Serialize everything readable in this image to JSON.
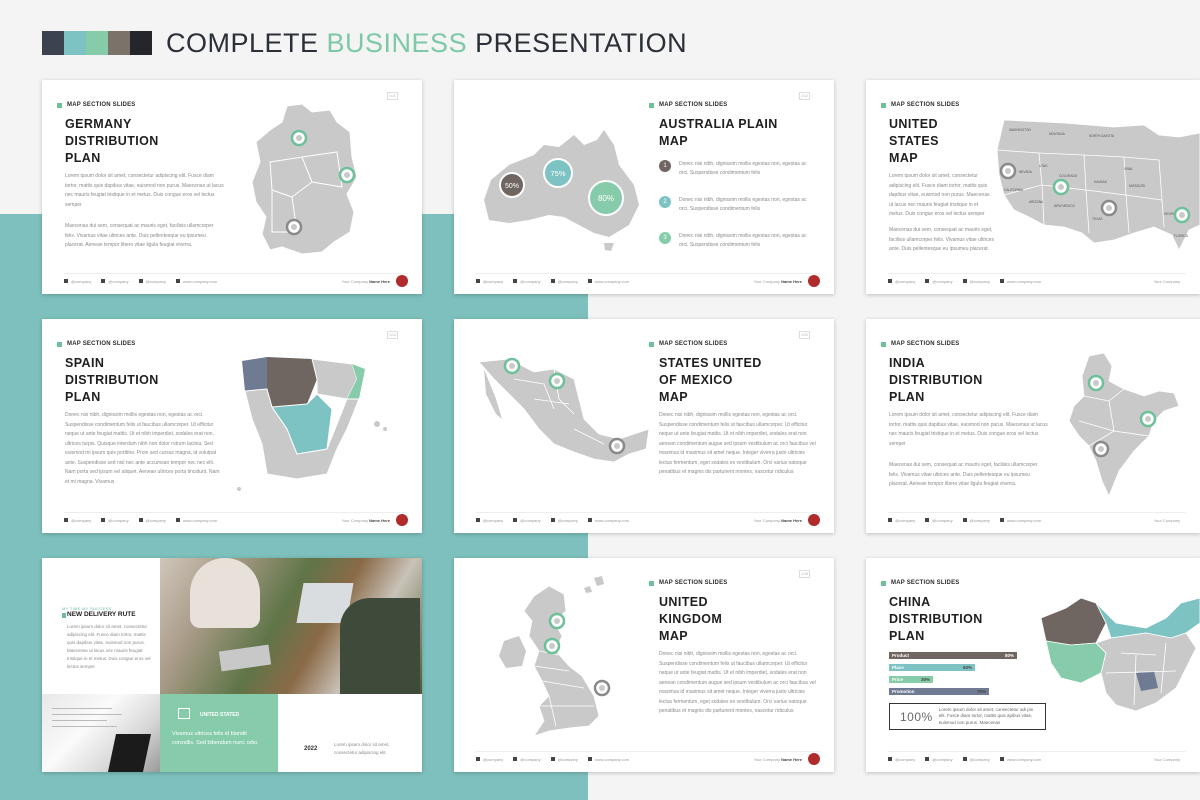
{
  "header": {
    "title_part1": "COMPLETE ",
    "title_accent": "BUSINESS",
    "title_part2": " PRESENTATION",
    "swatches": [
      "#3d4250",
      "#7ec3c4",
      "#86ccaa",
      "#7b7269",
      "#24262b"
    ]
  },
  "colors": {
    "teal_band": "#7dc0bd",
    "accent_green": "#7dc9a7",
    "map_gray": "#c9c9c9",
    "map_brown": "#6f6661",
    "map_slate": "#6f7a93",
    "pin_green": "#6cc09a",
    "pin_gray": "#8a8a8a"
  },
  "common": {
    "section_tag": "MAP SECTION SLIDES",
    "company": "Your Company",
    "company_name": "Name Here",
    "social": [
      "@company",
      "@company",
      "@company",
      "@company",
      "www.company.com"
    ],
    "social_icons": [
      "twitter-icon",
      "facebook-icon",
      "linkedin-icon",
      "instagram-icon",
      "web-icon"
    ]
  },
  "slides": {
    "germany": {
      "heading": "GERMANY\nDISTRIBUTION\nPLAN",
      "page": "101",
      "para1": "Lorem ipsum dolor sit amet, consectetur adipiscing elit. Fusce diam tortor, mattis quis dapibus vitae, euismod non purus. Maecenas ut lacus nec mauris feugiat tristique in et metus. Duis congue eros vel lectus semper",
      "para2": "Maecenas dui sem, consequat ac mauris eget, facilisis ullamcorper felis. Vivamus vitae ultrices ante. Duis pellentesque eu ipsumeu placerat. Aenean tempor libero vitae ligula feugiat viverra."
    },
    "australia": {
      "heading": "AUSTRALIA PLAIN\nMAP",
      "page": "102",
      "bubbles": [
        "50%",
        "75%",
        "80%"
      ],
      "items": [
        {
          "num": "1",
          "text": "Donec nisi nibh, dignissim mollis egestas non, egestas ac orci. Suspendisse condimentum felis",
          "color": "#6f6661"
        },
        {
          "num": "2",
          "text": "Donec nisi nibh, dignissim mollis egestas non, egestas ac orci. Suspendisse condimentum felis",
          "color": "#7ec3c4"
        },
        {
          "num": "3",
          "text": "Donec nisi nibh, dignissim mollis egestas non, egestas ac orci. Suspendisse condimentum felis",
          "color": "#86ccaa"
        }
      ]
    },
    "usa": {
      "heading": "UNITED\nSTATES\nMAP",
      "para1": "Lorem ipsum dolor sit amet, consectetur adipiscing elit. Fusce diam tortor, mattis quis dapibus vitae, euismod non purus. Maecenas ut lacus nec mauris feugiat tristique in et metus. Duis congue eros vel lectus semper",
      "para2": "Maecenas dui sem, consequat ac mauris eget, facilisis ullamcorper felis. Vivamus vitae ultrices ante. Duis pellentesque eu ipsumeu placerat.",
      "states": [
        "WASHINGTON",
        "MONTANA",
        "NORTH DAKOTA",
        "CALIFORNIA",
        "NEVADA",
        "UTAH",
        "COLORADO",
        "KANSAS",
        "TEXAS",
        "NEW MEXICO",
        "ARIZONA",
        "IOWA",
        "MISSOURI",
        "GEORGIA",
        "FLORIDA"
      ]
    },
    "spain": {
      "heading": "SPAIN\nDISTRIBUTION\nPLAN",
      "page": "104",
      "para": "Donec nisi nibh, dignissim mollis egestas non, egestas ac orci. Suspendisse condimentum felis ut faucibus ullamcorper. Ut efficitur neque ut ante feugiat mattis. Ut et nibh imperdiet, sodales erat non, ultrices turpis. Quisque interdum nibh non dolor rutrum lacinia. Sed euismod mi ipsum quis porttitor. Proin sed cursus magna, id volutpat ante. Suspendisse sed nisl nec ante accumsan tempor nec nec elit. Nam porta sed ipsum vel aliquet. Aenean ultrices porta tincidunt. Nam et mi magna. Vivamus"
    },
    "mexico": {
      "heading": "STATES UNITED\nOF MEXICO\nMAP",
      "page": "105",
      "para": "Donec nisi nibh, dignissim mollis egestas non, egestas ac orci. Suspendisse condimentum felis ut faucibus ullamcorper. Ut efficitur neque ut ante feugiat mattis. Ut et nibh imperdiet, sodales erat non aenean condimentum augue sed ipsum vestibulum ac orci faucibus vel maximus id maximus sit amet neque. Integer viverra justo ultricies lectus fermentum, eget sodales ex vestibulum. Orci varius natoque penatibus et magnis dis parturient montes, nascetur ridiculus"
    },
    "india": {
      "heading": "INDIA\nDISTRIBUTION\nPLAN",
      "para1": "Lorem ipsum dolor sit amet, consectetur adipiscing elit. Fusce diam tortor, mattis quis dapibus vitae, euismod non purus. Maecenas ut lacus nec mauris feugiat tristique in et metus. Duis congue eros vel lectus semper",
      "para2": "Maecenas dui sem, consequat ac mauris eget, facilisis ullamcorper felis. Vivamus vitae ultrices ante. Duis pellentesque eu ipsumeu placerat. Aenean tempor libero vitae ligula feugiat viverra."
    },
    "photo": {
      "small_tag": "MY TIME MY SUCCESS",
      "title": "NEW DELIVERY RUTE",
      "para": "Lorem ipsum dolor sit amet, consectetur adipiscing elit. Fusce diam tortor, mattis quis dapibus vitae, euismod non purus. Maecenas ut lacus nec mauris feugiat tristique in et metus. Duis congue eros vel lectus semper",
      "box_title": "UNITED STATED",
      "box_text": "Vivamus ultrices felis id blandit convallis. Sed bibendum nunc odio.",
      "year": "2022",
      "year_text": "Lorem ipsum dolor sit amet, consectetur adipiscing elit."
    },
    "uk": {
      "heading": "UNITED\nKINGDOM\nMAP",
      "page": "108",
      "para": "Donec nisi nibh, dignissim mollis egestas non, egestas ac orci. Suspendisse condimentum felis ut faucibus ullamcorper. Ut efficitur neque ut ante feugiat mattis. Ut et nibh imperdiet, sodales erat non aenean condimentum augue sed ipsum vestibulum ac orci faucibus vel maximus id maximus sit amet neque. Integer viverra justo ultricies lectus fermentum, eget sodales ex vestibulum. Orci varius natoque penatibus et magnis dis parturient montes, nascetur ridiculus"
    },
    "china": {
      "heading": "CHINA\nDISTRIBUTION\nPLAN",
      "bars": [
        {
          "label": "Product",
          "value": "80%",
          "pct": 80,
          "color": "#6f6661"
        },
        {
          "label": "Place",
          "value": "60%",
          "pct": 60,
          "color": "#7ec3c4"
        },
        {
          "label": "Price",
          "value": "30%",
          "pct": 30,
          "color": "#86ccaa"
        },
        {
          "label": "Promotion",
          "value": "70%",
          "pct": 70,
          "color": "#6f7a93"
        }
      ],
      "big": "100%",
      "box_text": "Lorem ipsum dolor sit amet, consectetur adi pis elit. Fusce diam tortor, mattis quis apibus vitae, euismod non purus. Maecenas"
    }
  }
}
